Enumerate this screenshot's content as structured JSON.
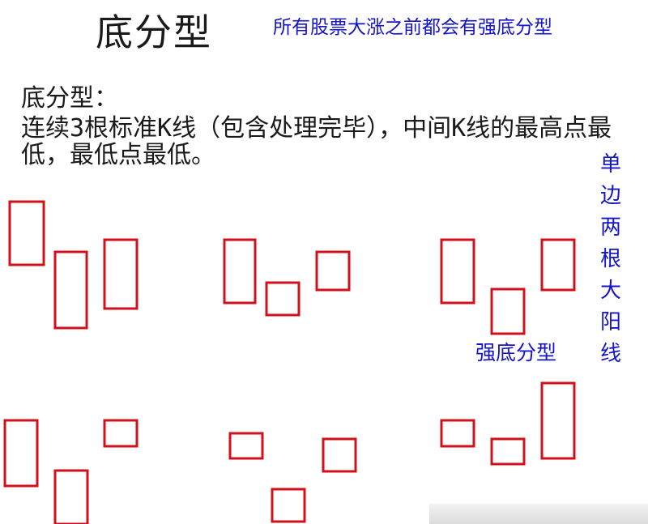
{
  "title": "底分型",
  "banner": "所有股票大涨之前都会有强底分型",
  "definition": {
    "heading": "底分型：",
    "body": "连续3根标准K线（包含处理完毕），中间K线的最高点最低，最低点最低。"
  },
  "annotations": {
    "strong_pattern": "强底分型",
    "vertical_note": "单边两根大阳线"
  },
  "colors": {
    "candle_stroke": "#d0111b",
    "annotation": "#1414c8",
    "text": "#1a1a1a"
  },
  "patterns": [
    {
      "name": "pattern-1",
      "bars": 3
    },
    {
      "name": "pattern-2",
      "bars": 3
    },
    {
      "name": "pattern-strong",
      "bars": 3
    },
    {
      "name": "pattern-4",
      "bars": 3
    },
    {
      "name": "pattern-5",
      "bars": 3
    },
    {
      "name": "pattern-6",
      "bars": 3
    }
  ]
}
